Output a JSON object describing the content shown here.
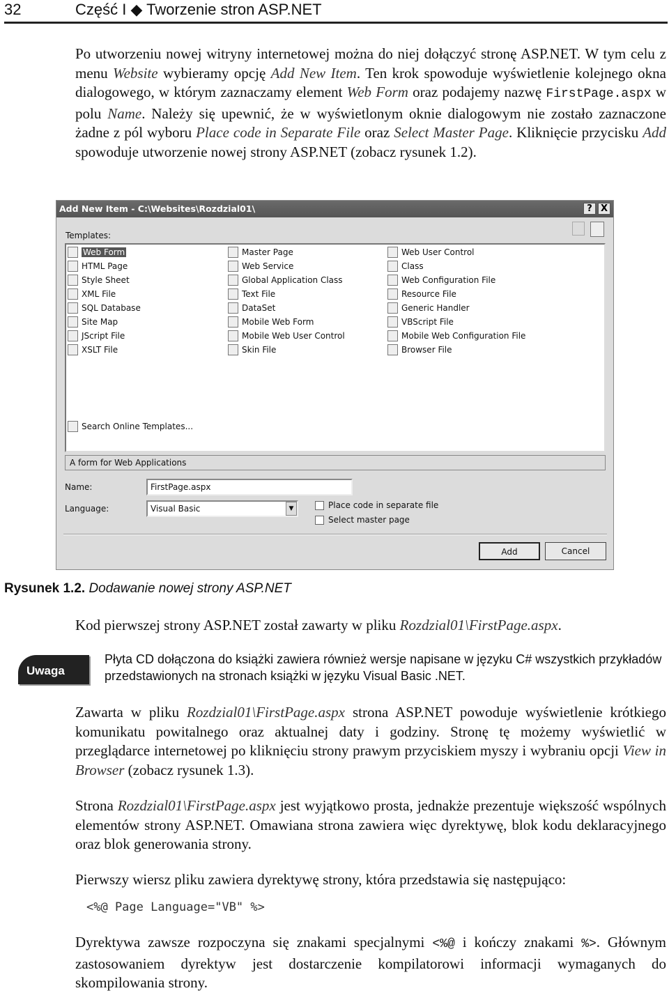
{
  "header": {
    "page_number": "32",
    "running_title": "Część I ◆ Tworzenie stron ASP.NET"
  },
  "paragraphs": [
    [
      {
        "t": "Po utworzeniu nowej witryny internetowej można do niej dołączyć stronę ASP.NET. W tym celu z menu "
      },
      {
        "t": "Website",
        "s": "i"
      },
      {
        "t": " wybieramy opcję "
      },
      {
        "t": "Add New Item",
        "s": "i"
      },
      {
        "t": ". Ten krok spowoduje wyświetlenie kolejnego okna dialogowego, w którym zaznaczamy element "
      },
      {
        "t": "Web Form",
        "s": "i"
      },
      {
        "t": " oraz podajemy nazwę "
      },
      {
        "t": "FirstPage.aspx",
        "s": "m"
      },
      {
        "t": " w polu "
      },
      {
        "t": "Name",
        "s": "i"
      },
      {
        "t": ". Należy się upewnić, że w wyświetlonym oknie dialogowym nie zostało zaznaczone żadne z pól wyboru "
      },
      {
        "t": "Place code in Separate File",
        "s": "i"
      },
      {
        "t": " oraz "
      },
      {
        "t": "Select Master Page",
        "s": "i"
      },
      {
        "t": ". Kliknięcie przycisku "
      },
      {
        "t": "Add",
        "s": "i"
      },
      {
        "t": " spowoduje utworzenie nowej strony ASP.NET (zobacz rysunek 1.2)."
      }
    ],
    [
      {
        "t": "Kod pierwszej strony ASP.NET został zawarty w pliku "
      },
      {
        "t": "Rozdzial01\\FirstPage.aspx",
        "s": "i"
      },
      {
        "t": "."
      }
    ],
    [
      {
        "t": "Zawarta w pliku "
      },
      {
        "t": "Rozdzial01\\FirstPage.aspx",
        "s": "i"
      },
      {
        "t": " strona ASP.NET powoduje wyświetlenie krótkiego komunikatu powitalnego oraz aktualnej daty i godziny. Stronę tę możemy wyświetlić w przeglądarce internetowej po kliknięciu strony prawym przyciskiem myszy i wybraniu opcji "
      },
      {
        "t": "View in Browser",
        "s": "i"
      },
      {
        "t": " (zobacz rysunek 1.3)."
      }
    ],
    [
      {
        "t": "Strona "
      },
      {
        "t": "Rozdzial01\\FirstPage.aspx",
        "s": "i"
      },
      {
        "t": " jest wyjątkowo prosta, jednakże prezentuje większość wspólnych elementów strony ASP.NET. Omawiana strona zawiera więc dyrektywę, blok kodu deklaracyjnego oraz blok generowania strony."
      }
    ],
    [
      {
        "t": "Pierwszy wiersz pliku zawiera dyrektywę strony, która przedstawia się następująco:"
      }
    ],
    [
      {
        "t": "Dyrektywa zawsze rozpoczyna się znakami specjalnymi "
      },
      {
        "t": "<%@",
        "s": "m"
      },
      {
        "t": " i kończy znakami "
      },
      {
        "t": "%>",
        "s": "m"
      },
      {
        "t": ". Głównym zastosowaniem dyrektyw jest dostarczenie kompilatorowi informacji wymaganych do skompilowania strony."
      }
    ]
  ],
  "dialog": {
    "title": "Add New Item - C:\\Websites\\Rozdzial01\\",
    "help_label": "?",
    "close_label": "X",
    "templates_label": "Templates:",
    "templates": [
      [
        "Web Form",
        "HTML Page",
        "Style Sheet",
        "XML File",
        "SQL Database",
        "Site Map",
        "JScript File",
        "XSLT File"
      ],
      [
        "Master Page",
        "Web Service",
        "Global Application Class",
        "Text File",
        "DataSet",
        "Mobile Web Form",
        "Mobile Web User Control",
        "Skin File"
      ],
      [
        "Web User Control",
        "Class",
        "Web Configuration File",
        "Resource File",
        "Generic Handler",
        "VBScript File",
        "Mobile Web Configuration File",
        "Browser File"
      ]
    ],
    "selected_template": "Web Form",
    "search_online": "Search Online Templates...",
    "description": "A form for Web Applications",
    "name_label": "Name:",
    "name_value": "FirstPage.aspx",
    "language_label": "Language:",
    "language_value": "Visual Basic",
    "place_code_label": "Place code in separate file",
    "place_code_checked": false,
    "master_page_label": "Select master page",
    "master_page_checked": false,
    "add_label": "Add",
    "cancel_label": "Cancel"
  },
  "caption": {
    "number": "Rysunek 1.2.",
    "text": "Dodawanie nowej strony ASP.NET"
  },
  "note": {
    "badge": "Uwaga",
    "text": "Płyta CD dołączona do książki zawiera również wersje napisane w języku C# wszystkich przykładów przedstawionych na stronach książki w języku Visual Basic .NET."
  },
  "code_line": "<%@ Page Language=\"VB\" %>"
}
